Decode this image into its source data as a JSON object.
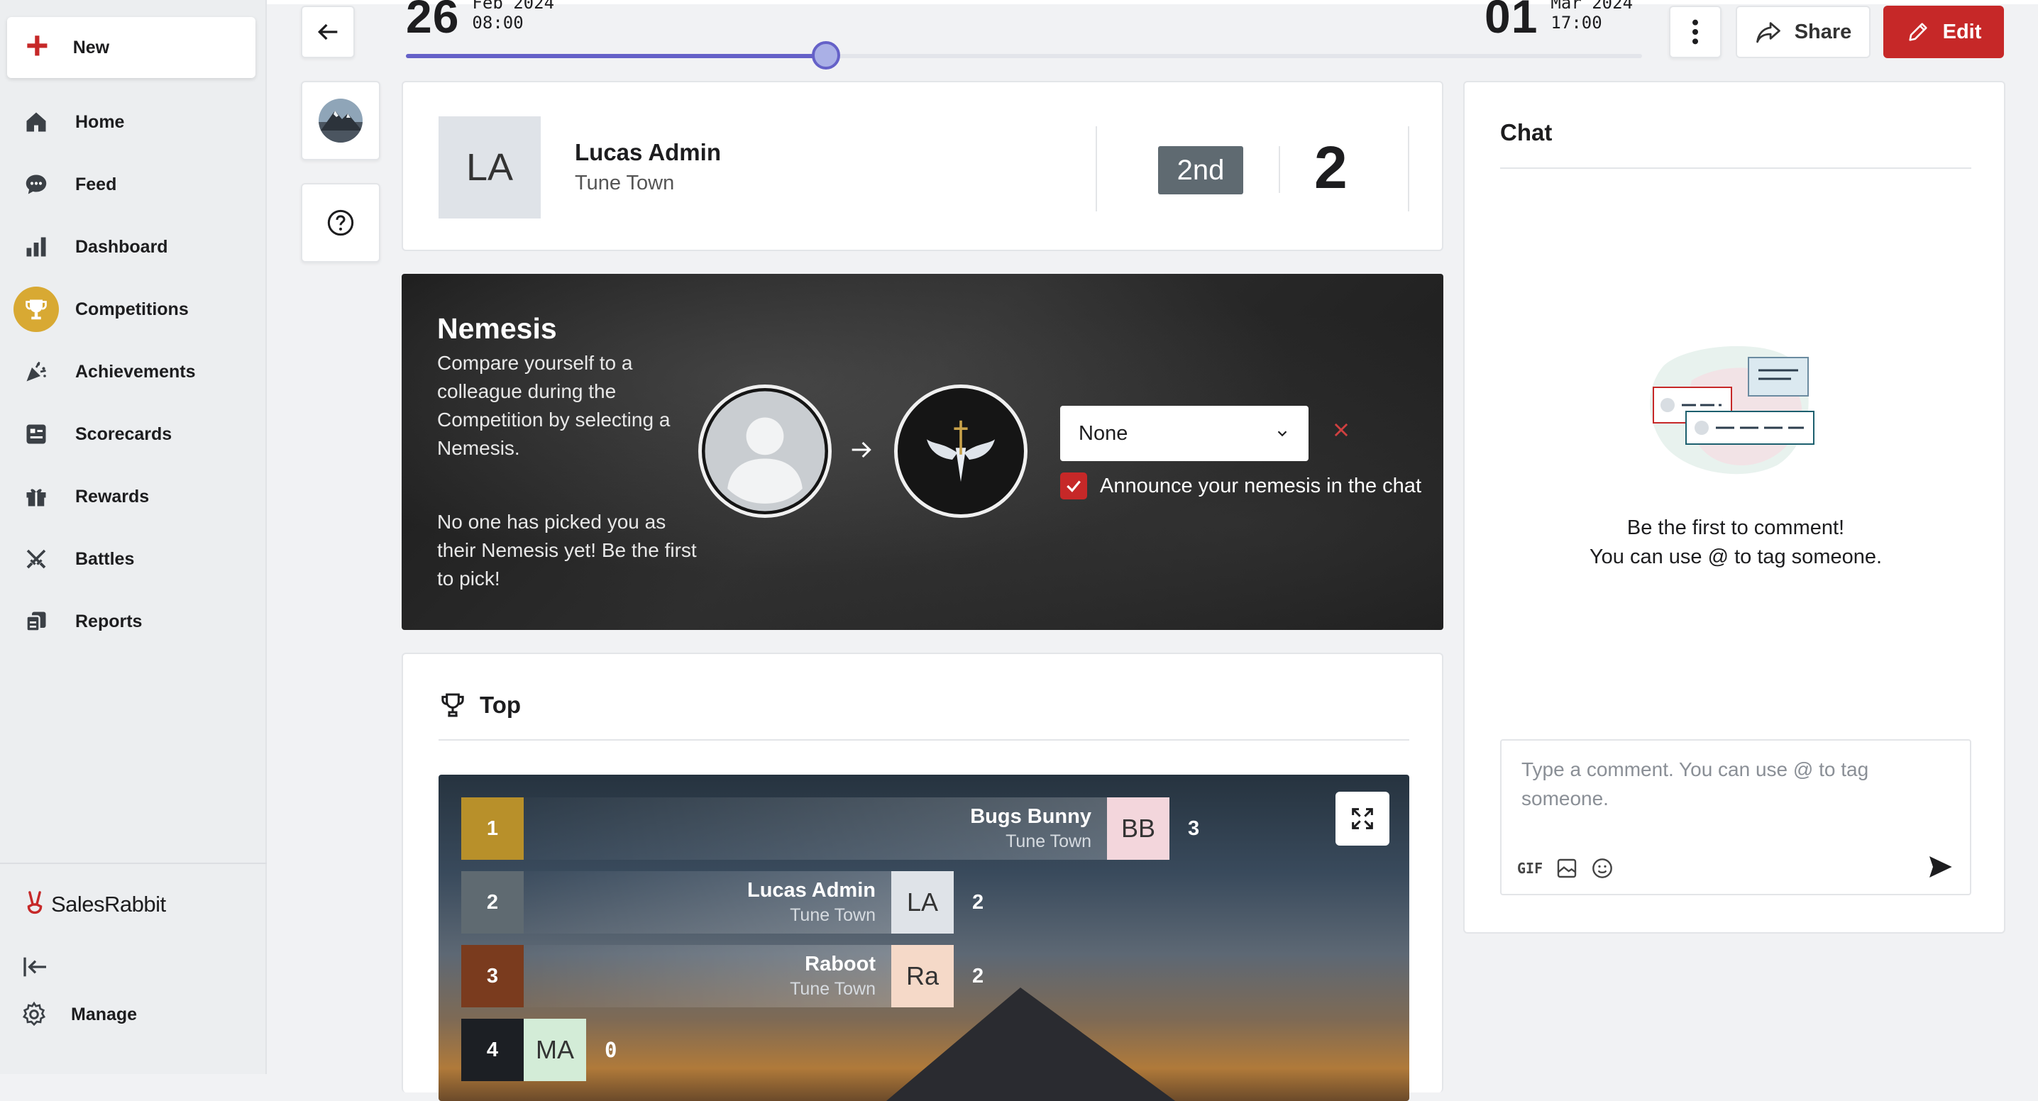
{
  "sidebar": {
    "new_label": "New",
    "items": [
      {
        "label": "Home",
        "icon": "home-icon"
      },
      {
        "label": "Feed",
        "icon": "chat-bubble-icon"
      },
      {
        "label": "Dashboard",
        "icon": "bar-chart-icon"
      },
      {
        "label": "Competitions",
        "icon": "trophy-icon",
        "active": true
      },
      {
        "label": "Achievements",
        "icon": "party-popper-icon"
      },
      {
        "label": "Scorecards",
        "icon": "scorecard-icon"
      },
      {
        "label": "Rewards",
        "icon": "gift-icon"
      },
      {
        "label": "Battles",
        "icon": "crossed-swords-icon"
      },
      {
        "label": "Reports",
        "icon": "report-icon"
      }
    ],
    "brand": "SalesRabbit",
    "manage_label": "Manage"
  },
  "timeline": {
    "start_day": "26",
    "start_month": "Feb 2024",
    "start_time": "08:00",
    "end_day": "01",
    "end_month": "Mar 2024",
    "end_time": "17:00",
    "progress": 0.34
  },
  "toolbar": {
    "share_label": "Share",
    "edit_label": "Edit"
  },
  "profile": {
    "initials": "LA",
    "name": "Lucas Admin",
    "team": "Tune Town",
    "rank": "2nd",
    "score": "2"
  },
  "nemesis": {
    "title": "Nemesis",
    "description": "Compare yourself to a colleague during the Competition by selecting a Nemesis.",
    "note": "No one has picked you as their Nemesis yet! Be the first to pick!",
    "select_value": "None",
    "announce_label": "Announce your nemesis in the chat",
    "announce_checked": true
  },
  "leaderboard": {
    "title": "Top",
    "rows": [
      {
        "rank": "1",
        "name": "Bugs Bunny",
        "team": "Tune Town",
        "initials": "BB",
        "score": "3",
        "rank_color": "#b8902a",
        "ini_bg": "#f3d6dc"
      },
      {
        "rank": "2",
        "name": "Lucas Admin",
        "team": "Tune Town",
        "initials": "LA",
        "score": "2",
        "rank_color": "#5f6a71",
        "ini_bg": "#dfe3e8"
      },
      {
        "rank": "3",
        "name": "Raboot",
        "team": "Tune Town",
        "initials": "Ra",
        "score": "2",
        "rank_color": "#7a3b1e",
        "ini_bg": "#f5d9c8"
      },
      {
        "rank": "4",
        "name": "",
        "team": "",
        "initials": "MA",
        "score": "0",
        "rank_color": "#1c1f24",
        "ini_bg": "#d3ecd7"
      }
    ]
  },
  "chat": {
    "title": "Chat",
    "empty_line1": "Be the first to comment!",
    "empty_line2": "You can use @ to tag someone.",
    "placeholder": "Type a comment. You can use @ to tag someone.",
    "gif_label": "GIF"
  },
  "colors": {
    "accent_red": "#c62828",
    "slider": "#6561c8",
    "active_nav": "#d8a933"
  }
}
